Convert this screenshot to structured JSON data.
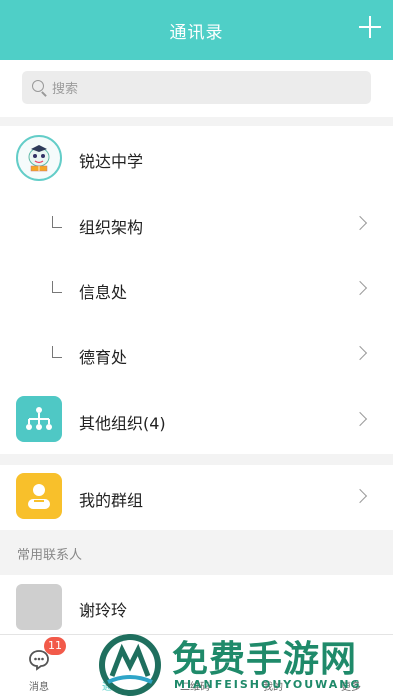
{
  "header": {
    "title": "通讯录",
    "add_icon": "plus-icon"
  },
  "search": {
    "placeholder": "搜索"
  },
  "org": {
    "school": "锐达中学",
    "departments": [
      "组织架构",
      "信息处",
      "德育处"
    ],
    "other_orgs": "其他组织(4)"
  },
  "groups": {
    "my_groups": "我的群组"
  },
  "contacts": {
    "section_title": "常用联系人",
    "items": [
      {
        "name": "谢玲玲"
      }
    ]
  },
  "tabbar": {
    "items": [
      {
        "label": "消息",
        "badge": "11",
        "icon": "chat-icon"
      },
      {
        "label": "通讯录",
        "icon": "contacts-icon"
      },
      {
        "label": "二维码",
        "icon": "qrcode-icon"
      },
      {
        "label": "我的",
        "icon": "user-icon"
      },
      {
        "label": "更多",
        "icon": "more-icon"
      }
    ]
  },
  "watermark": {
    "title": "免费手游网",
    "subtitle": "MIANFEISHOUYOUWANG"
  },
  "colors": {
    "accent": "#4fcfc7",
    "group": "#f8c02b",
    "badge": "#f25a4a"
  }
}
